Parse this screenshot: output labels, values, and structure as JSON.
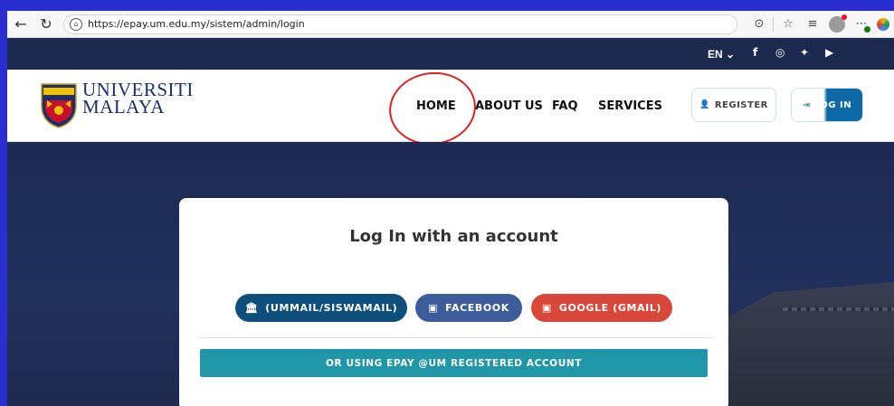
{
  "browser": {
    "url": "https://epay.um.edu.my/sistem/admin/login",
    "back_icon": "←",
    "refresh_icon": "↻",
    "lock_icon": "🔒"
  },
  "topbar": {
    "language": "EN ⌄",
    "social": [
      "f",
      "◎",
      "🐦",
      "▶"
    ]
  },
  "header": {
    "university_line1": "UNIVERSITI",
    "university_line2": "MALAYA",
    "menu": [
      "HOME",
      "ABOUT US",
      "FAQ",
      "SERVICES"
    ],
    "register_label": "REGISTER",
    "login_label": "LOG IN"
  },
  "card": {
    "title": "Log In with an account",
    "um_button": "(UMMAIL/SISWAMAIL)",
    "facebook_button": "FACEBOOK",
    "google_button": "GOOGLE (GMAIL)",
    "epay_button": "OR USING EPAY @UM REGISTERED ACCOUNT"
  },
  "colors": {
    "brand_navy": "#1b2a4e",
    "um_button": "#0f4f7c",
    "facebook": "#3b5b99",
    "google": "#d9473a",
    "epay": "#1f97a8",
    "annotation": "#e02020"
  }
}
